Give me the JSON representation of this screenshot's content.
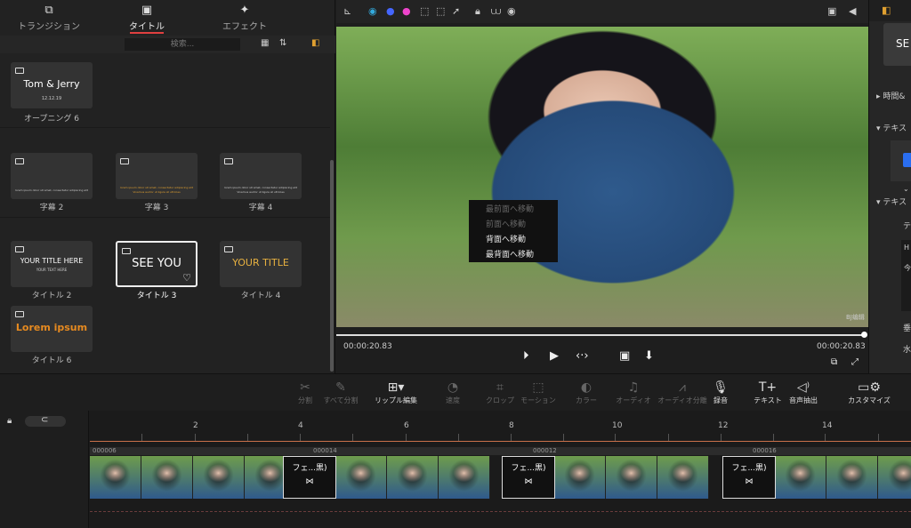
{
  "tabs": [
    {
      "label": "トランジション",
      "icon": "transition-icon"
    },
    {
      "label": "タイトル",
      "icon": "title-icon"
    },
    {
      "label": "エフェクト",
      "icon": "effect-icon"
    }
  ],
  "search": {
    "placeholder": "検索..."
  },
  "thumbnails": {
    "opening6": {
      "line1": "Tom & Jerry",
      "line2": "12.12.19",
      "label": "オープニング 6"
    },
    "sub2": {
      "tiny": "lorem ipsum dolor sit amet, consectetur adipiscing elit",
      "label": "字幕 2"
    },
    "sub3": {
      "tiny": "lorem ipsum dolor sit amet, consectetur adipiscing elit",
      "tiny2": "Vivamus auctor ut ligula at ultricies",
      "label": "字幕 3"
    },
    "sub4": {
      "tiny": "lorem ipsum dolor sit amet, consectetur adipiscing elit",
      "tiny2": "Vivamus auctor ut ligula at ultricies",
      "label": "字幕 4"
    },
    "title2": {
      "line1": "YOUR TITLE HERE",
      "line2": "YOUR TEXT HERE",
      "label": "タイトル 2"
    },
    "title3": {
      "line1": "SEE YOU",
      "label": "タイトル 3"
    },
    "title4": {
      "line1": "YOUR TITLE",
      "label": "タイトル 4"
    },
    "title6": {
      "line1": "Lorem ipsum",
      "label": "タイトル 6"
    }
  },
  "context_menu": [
    {
      "label": "最前面へ移動",
      "enabled": false
    },
    {
      "label": "前面へ移動",
      "enabled": false
    },
    {
      "label": "背面へ移動",
      "enabled": true
    },
    {
      "label": "最背面へ移動",
      "enabled": true
    }
  ],
  "video_watermark": "BJ编辑",
  "playback": {
    "current": "00:00:20.83",
    "total": "00:00:20.83"
  },
  "right_panel": {
    "title_preview": "SE",
    "row1": "時間&",
    "row2": "テキス",
    "row3": "テキス",
    "row4": "テ",
    "row5": "H",
    "row6": "今",
    "row7": "垂",
    "row8": "水"
  },
  "toolbar": [
    {
      "label": "分割",
      "icon": "scissors-icon",
      "enabled": false
    },
    {
      "label": "すべて分割",
      "icon": "split-all-icon",
      "enabled": false
    },
    {
      "label": "リップル編集",
      "icon": "ripple-edit-icon",
      "enabled": true
    },
    {
      "label": "速度",
      "icon": "speed-icon",
      "enabled": false
    },
    {
      "label": "クロップ",
      "icon": "crop-icon",
      "enabled": false
    },
    {
      "label": "モーション",
      "icon": "motion-icon",
      "enabled": false
    },
    {
      "label": "カラー",
      "icon": "color-icon",
      "enabled": false
    },
    {
      "label": "オーディオ",
      "icon": "audio-icon",
      "enabled": false
    },
    {
      "label": "オーディオ分離",
      "icon": "audio-detach-icon",
      "enabled": false
    },
    {
      "label": "録音",
      "icon": "mic-icon",
      "enabled": true
    },
    {
      "label": "テキスト",
      "icon": "text-icon",
      "enabled": true
    },
    {
      "label": "音声抽出",
      "icon": "voice-extract-icon",
      "enabled": true
    },
    {
      "label": "カスタマイズ",
      "icon": "customize-icon",
      "enabled": true
    }
  ],
  "ruler_labels": [
    "2",
    "4",
    "6",
    "8",
    "10",
    "12",
    "14"
  ],
  "clip_ids": [
    "000006",
    "000014",
    "000012",
    "000016"
  ],
  "transitions": [
    "フェ...黒)",
    "フェ...黒)",
    "フェ...黒)"
  ]
}
